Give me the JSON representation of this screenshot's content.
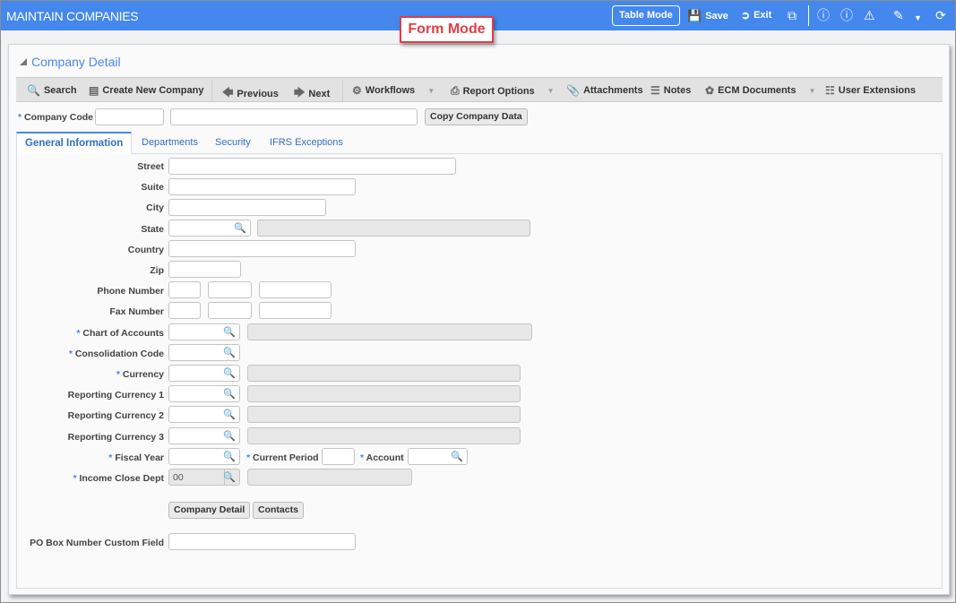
{
  "window": {
    "title": "MAINTAIN COMPANIES"
  },
  "header": {
    "table_mode_label": "Table Mode",
    "save_label": "Save",
    "exit_label": "Exit",
    "icons": [
      "save-icon",
      "exit-icon",
      "copy-icon",
      "info-icon",
      "help-icon",
      "warning-icon",
      "edit-icon",
      "dropdown-icon",
      "refresh-icon"
    ]
  },
  "callout": {
    "label": "Form Mode"
  },
  "section": {
    "title": "Company Detail"
  },
  "toolbar": {
    "search": "Search",
    "create": "Create New Company",
    "previous": "Previous",
    "next": "Next",
    "workflows": "Workflows",
    "report_options": "Report Options",
    "attachments": "Attachments",
    "notes": "Notes",
    "ecm": "ECM Documents",
    "user_ext": "User Extensions"
  },
  "company": {
    "required_mark": "*",
    "code_label": "Company Code",
    "code_value": "",
    "name_value": "",
    "copy_button": "Copy Company Data"
  },
  "tabs": [
    {
      "label": "General Information",
      "active": true
    },
    {
      "label": "Departments",
      "active": false
    },
    {
      "label": "Security",
      "active": false
    },
    {
      "label": "IFRS Exceptions",
      "active": false
    }
  ],
  "fields": {
    "street": "Street",
    "suite": "Suite",
    "city": "City",
    "state": "State",
    "country": "Country",
    "zip": "Zip",
    "phone": "Phone Number",
    "fax": "Fax Number",
    "chart_of_accounts": "Chart of Accounts",
    "consolidation_code": "Consolidation Code",
    "currency": "Currency",
    "reporting_currency_1": "Reporting Currency 1",
    "reporting_currency_2": "Reporting Currency 2",
    "reporting_currency_3": "Reporting Currency 3",
    "fiscal_year": "Fiscal Year",
    "current_period": "Current Period",
    "account": "Account",
    "income_close_dept": "Income Close Dept",
    "income_close_dept_value": "00",
    "po_box": "PO Box Number Custom Field"
  },
  "buttons": {
    "company_detail": "Company Detail",
    "contacts": "Contacts"
  }
}
